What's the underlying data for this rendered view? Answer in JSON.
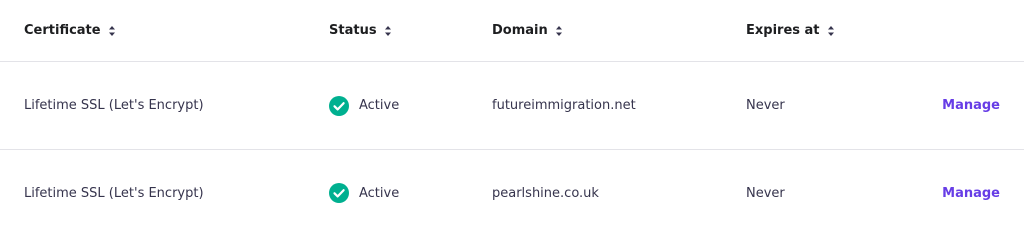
{
  "header": {
    "certificate": "Certificate",
    "status": "Status",
    "domain": "Domain",
    "expires_at": "Expires at",
    "sort_icon": "sort-up-down-icon"
  },
  "rows": [
    {
      "certificate": "Lifetime SSL (Let's Encrypt)",
      "status": "Active",
      "status_icon": "check-circle-icon",
      "domain": "futureimmigration.net",
      "expires_at": "Never",
      "action": "Manage"
    },
    {
      "certificate": "Lifetime SSL (Let's Encrypt)",
      "status": "Active",
      "status_icon": "check-circle-icon",
      "domain": "pearlshine.co.uk",
      "expires_at": "Never",
      "action": "Manage"
    }
  ],
  "colors": {
    "accent": "#673de6",
    "success": "#00b090",
    "text": "#36344d",
    "divider": "#e3e3e8"
  }
}
